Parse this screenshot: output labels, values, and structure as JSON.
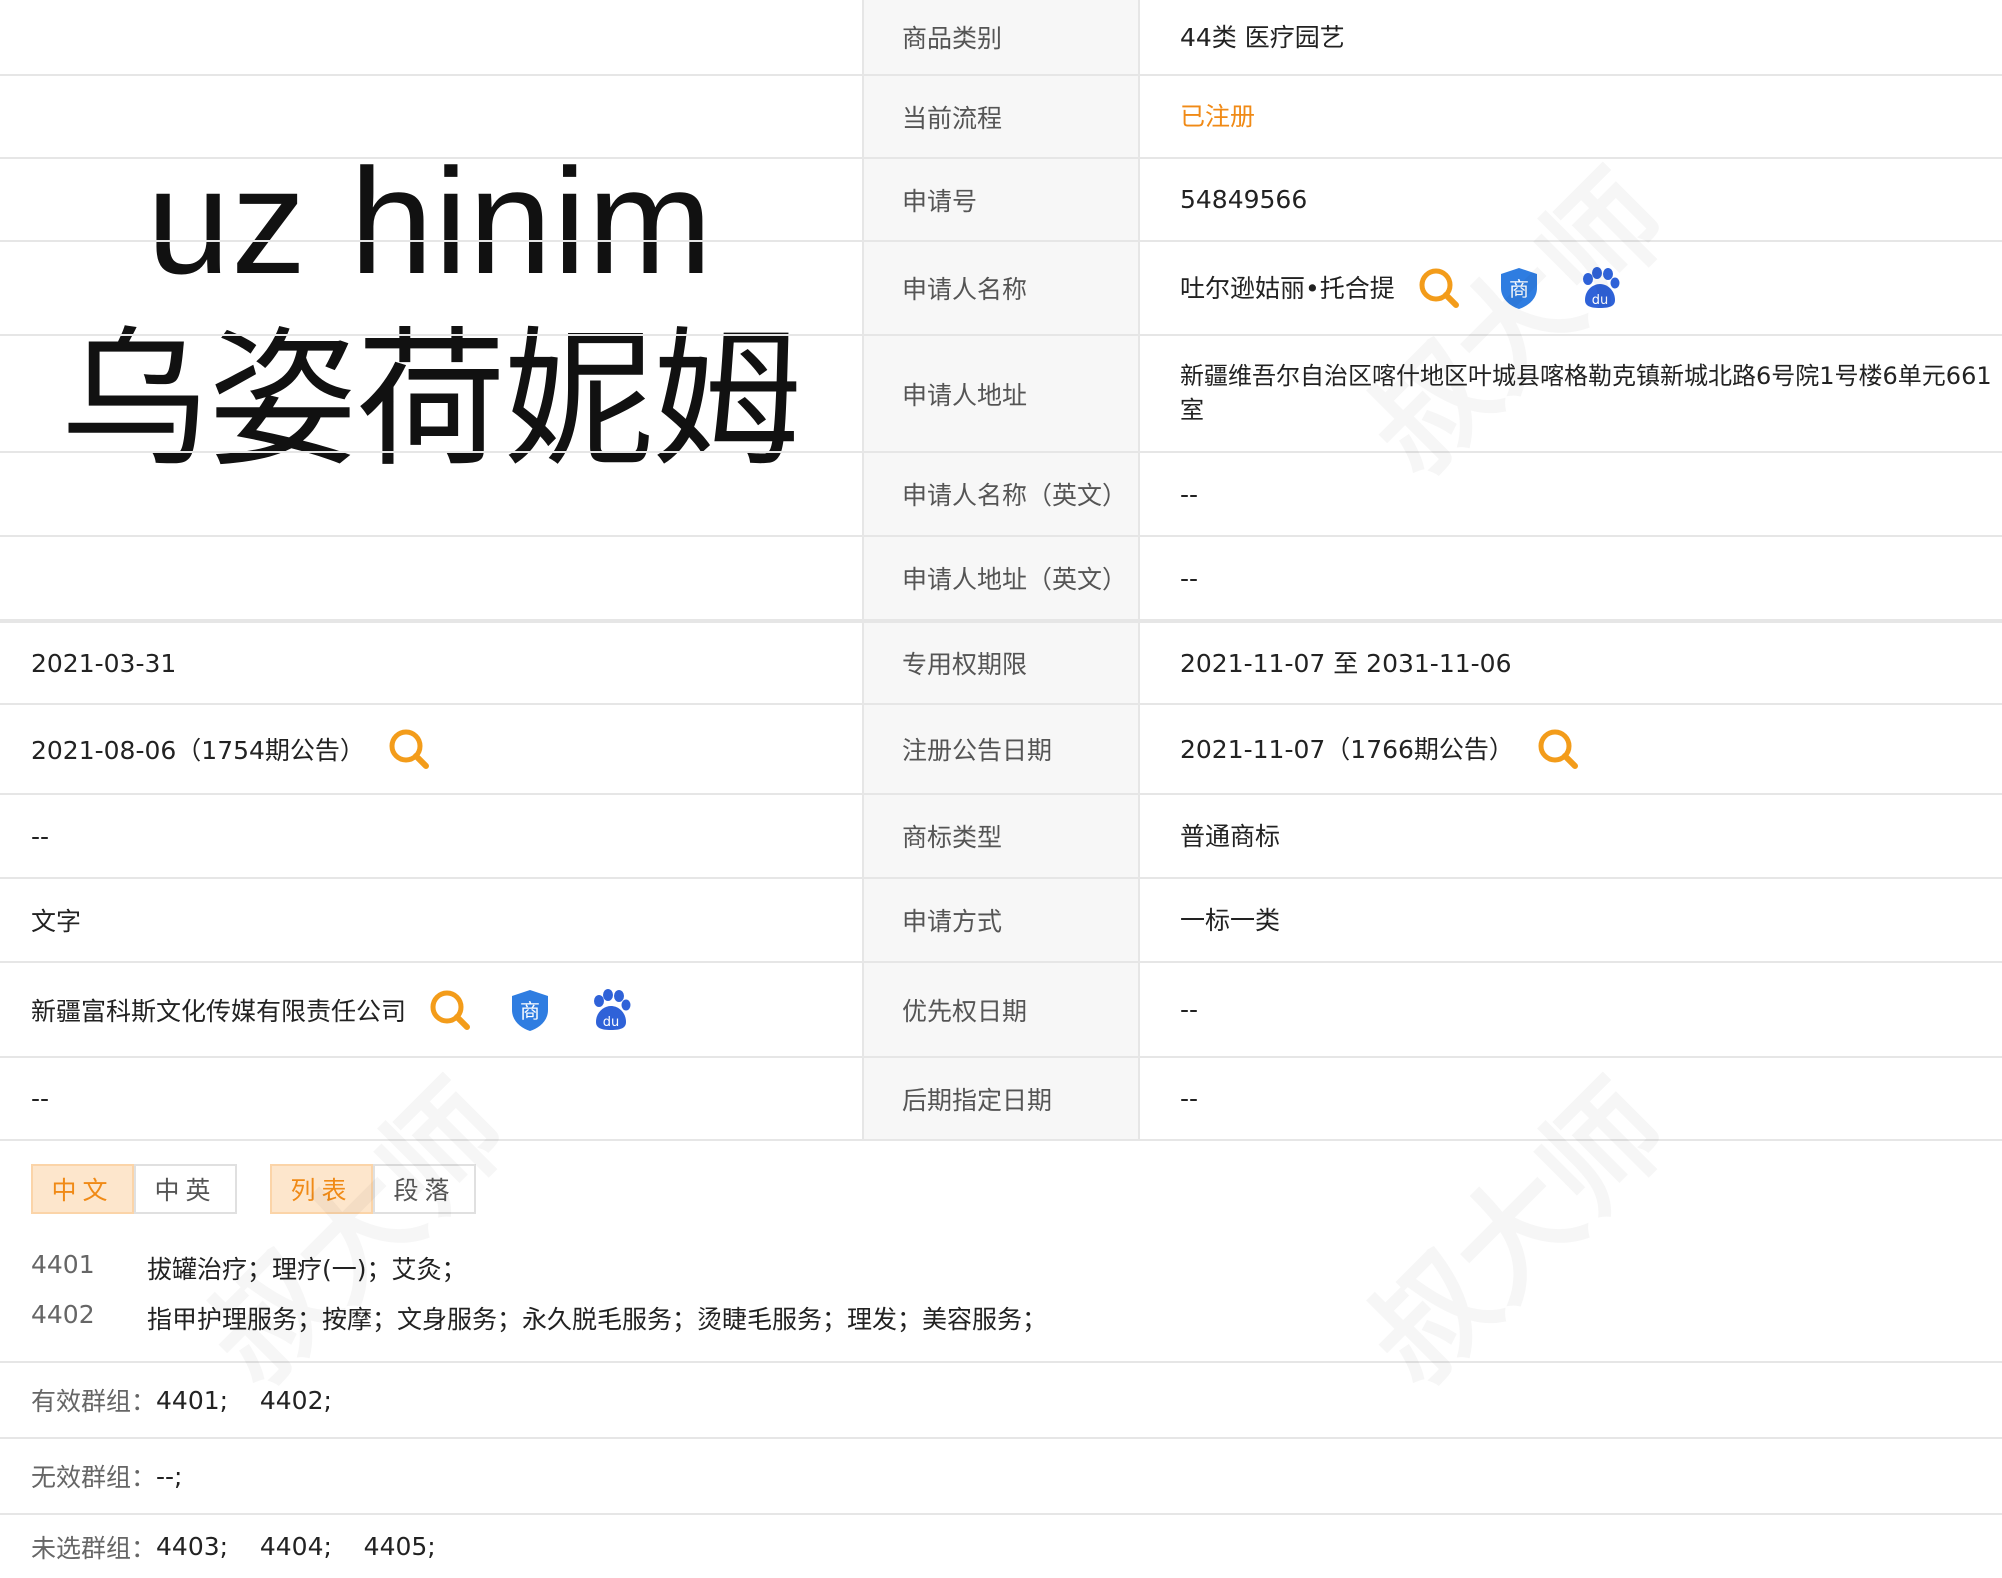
{
  "logo": {
    "en": "uz hinim",
    "zh": "乌姿荷妮姆"
  },
  "watermark": "叔大师",
  "rows": [
    {
      "label": "商品类别",
      "value": "44类 医疗园艺"
    },
    {
      "label": "当前流程",
      "value": "已注册"
    },
    {
      "label": "申请号",
      "value": "54849566"
    },
    {
      "label": "申请人名称",
      "value": "吐尔逊姑丽•托合提"
    },
    {
      "label": "申请人地址",
      "value": "新疆维吾尔自治区喀什地区叶城县喀格勒克镇新城北路6号院1号楼6单元661室"
    },
    {
      "label": "申请人名称（英文）",
      "value": "--"
    },
    {
      "label": "申请人地址（英文）",
      "value": "--"
    },
    {
      "left": "2021-03-31",
      "label": "专用权期限",
      "value": "2021-11-07 至 2031-11-06"
    },
    {
      "left": "2021-08-06（1754期公告）",
      "label": "注册公告日期",
      "value": "2021-11-07（1766期公告）"
    },
    {
      "left": "--",
      "label": "商标类型",
      "value": "普通商标"
    },
    {
      "left": "文字",
      "label": "申请方式",
      "value": "一标一类"
    },
    {
      "left": "新疆富科斯文化传媒有限责任公司",
      "label": "优先权日期",
      "value": "--"
    },
    {
      "left": "--",
      "label": "后期指定日期",
      "value": "--"
    }
  ],
  "tabs": {
    "lang": [
      "中文",
      "中英"
    ],
    "view": [
      "列表",
      "段落"
    ]
  },
  "services": [
    {
      "code": "4401",
      "text": "拔罐治疗；理疗(一)；艾灸；"
    },
    {
      "code": "4402",
      "text": "指甲护理服务；按摩；文身服务；永久脱毛服务；烫睫毛服务；理发；美容服务；"
    }
  ],
  "groups": [
    {
      "label": "有效群组：",
      "value": "4401;    4402;"
    },
    {
      "label": "无效群组：",
      "value": "--;"
    },
    {
      "label": "未选群组：",
      "value": "4403;    4404;    4405;"
    }
  ],
  "colors": {
    "accent": "#f08a16",
    "shield": "#2f7de1",
    "paw": "#2f62d8"
  }
}
